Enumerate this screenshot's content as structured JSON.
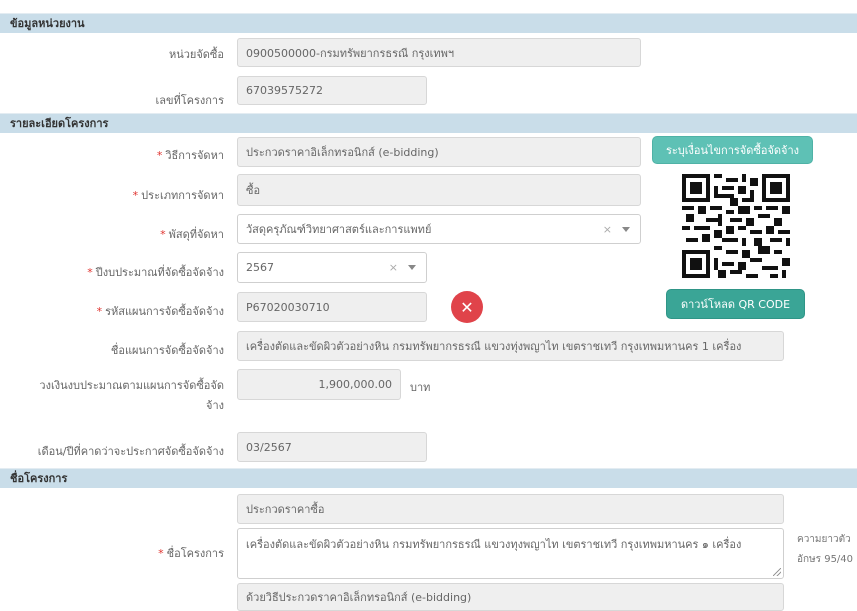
{
  "sections": {
    "agency": "ข้อมูลหน่วยงาน",
    "details": "รายละเอียดโครงการ",
    "project_name": "ชื่อโครงการ"
  },
  "fields": {
    "procuring_unit": {
      "label": "หน่วยจัดซื้อ",
      "value": "0900500000-กรมทรัพยากรธรณี กรุงเทพฯ"
    },
    "project_number": {
      "label": "เลขที่โครงการ",
      "value": "67039575272"
    },
    "procurement_method": {
      "label": "วิธีการจัดหา",
      "value": "ประกวดราคาอิเล็กทรอนิกส์ (e-bidding)"
    },
    "procurement_type": {
      "label": "ประเภทการจัดหา",
      "value": "ซื้อ"
    },
    "supply_category": {
      "label": "พัสดุที่จัดหา",
      "value": "วัสดุครุภัณฑ์วิทยาศาสตร์และการแพทย์"
    },
    "budget_year": {
      "label": "ปีงบประมาณที่จัดซื้อจัดจ้าง",
      "value": "2567"
    },
    "plan_code": {
      "label": "รหัสแผนการจัดซื้อจัดจ้าง",
      "value": "P67020030710"
    },
    "plan_name": {
      "label": "ชื่อแผนการจัดซื้อจัดจ้าง",
      "value": "เครื่องตัดและขัดผิวตัวอย่างหิน กรมทรัพยากรธรณี แขวงทุ่งพญาไท เขตราชเทวี กรุงเทพมหานคร 1 เครื่อง"
    },
    "budget_amount": {
      "label_line1": "วงเงินงบประมาณตามแผนการจัดซื้อจัด",
      "label_line2": "จ้าง",
      "value": "1,900,000.00",
      "unit": "บาท"
    },
    "announce_month": {
      "label": "เดือน/ปีที่คาดว่าจะประกาศจัดซื้อจัดจ้าง",
      "value": "03/2567"
    },
    "project_title": {
      "label": "ชื่อโครงการ",
      "prefix": "ประกวดราคาซื้อ",
      "value": "เครื่องตัดและขัดผิวตัวอย่างหิน กรมทรัพยากรธรณี แขวงทุงพญาไท เขตราชเทวี กรุงเทพมหานคร ๑ เครื่อง",
      "suffix": "ด้วยวิธีประกวดราคาอิเล็กทรอนิกส์ (e-bidding)",
      "length_note_line1": "ความยาวตัว",
      "length_note_line2": "อักษร 95/40"
    }
  },
  "select_clear": "×",
  "buttons": {
    "specify_conditions": "ระบุเงื่อนไขการจัดซื้อจัดจ้าง",
    "download_qr": "ดาวน์โหลด QR CODE",
    "remove_plan": "✕"
  },
  "colors": {
    "header_bg": "#c9dde9",
    "accent_green": "#5ec1b5",
    "danger_red": "#e0434a",
    "required_star": "#e0332f"
  },
  "icons": {
    "qr": "qr-code-icon",
    "remove": "close-circle-icon"
  }
}
